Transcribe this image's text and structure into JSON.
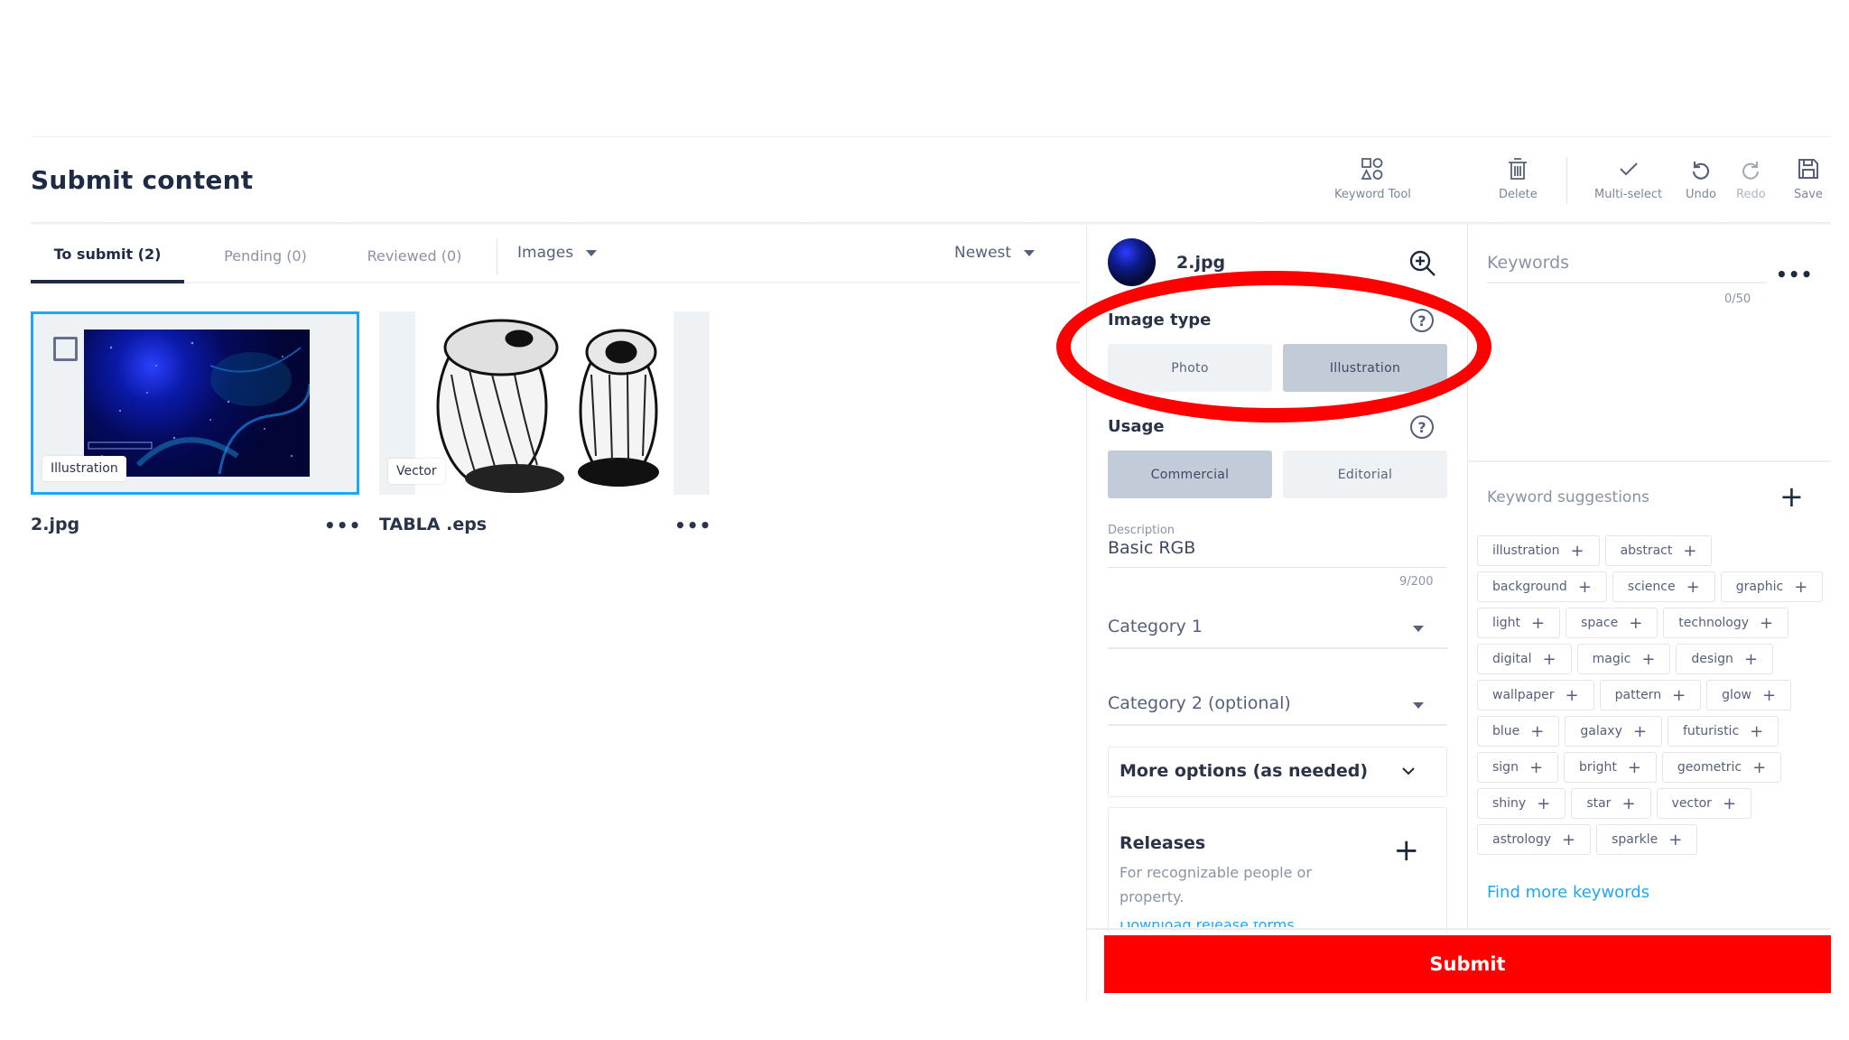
{
  "page": {
    "title": "Submit content"
  },
  "toolbar": {
    "keyword_tool": "Keyword Tool",
    "delete": "Delete",
    "multi_select": "Multi-select",
    "undo": "Undo",
    "redo": "Redo",
    "save": "Save"
  },
  "tabs": [
    {
      "label": "To submit (2)",
      "active": true
    },
    {
      "label": "Pending (0)",
      "active": false
    },
    {
      "label": "Reviewed (0)",
      "active": false
    }
  ],
  "filters": {
    "type": "Images",
    "sort": "Newest"
  },
  "files": [
    {
      "name": "2.jpg",
      "type_badge": "Illustration",
      "selected": true,
      "more": "•••"
    },
    {
      "name": "TABLA .eps",
      "type_badge": "Vector",
      "selected": false,
      "more": "•••"
    }
  ],
  "details": {
    "file_name": "2.jpg",
    "image_type": {
      "title": "Image type",
      "options": [
        "Photo",
        "Illustration"
      ],
      "selected": "Illustration"
    },
    "usage": {
      "title": "Usage",
      "options": [
        "Commercial",
        "Editorial"
      ],
      "selected": "Commercial"
    },
    "description": {
      "label": "Description",
      "value": "Basic RGB",
      "count": "9/200"
    },
    "category1": {
      "placeholder": "Category 1"
    },
    "category2": {
      "placeholder": "Category 2 (optional)"
    },
    "more_options": "More options (as needed)",
    "releases": {
      "title": "Releases",
      "subtitle": "For recognizable people or property.",
      "link": "Download release forms"
    },
    "help_icon": "?"
  },
  "keywords": {
    "placeholder": "Keywords",
    "count": "0/50",
    "more": "•••",
    "suggestions_title": "Keyword suggestions",
    "suggestions": [
      "illustration",
      "abstract",
      "background",
      "science",
      "graphic",
      "light",
      "space",
      "technology",
      "digital",
      "magic",
      "design",
      "wallpaper",
      "pattern",
      "glow",
      "blue",
      "galaxy",
      "futuristic",
      "sign",
      "bright",
      "geometric",
      "shiny",
      "star",
      "vector",
      "astrology",
      "sparkle"
    ],
    "find_more": "Find more keywords"
  },
  "submit": {
    "label": "Submit"
  },
  "colors": {
    "accent": "#1ea7f5",
    "submit": "#ff0000",
    "text": "#1f2a44",
    "selected_segment": "#c2cbd8"
  }
}
